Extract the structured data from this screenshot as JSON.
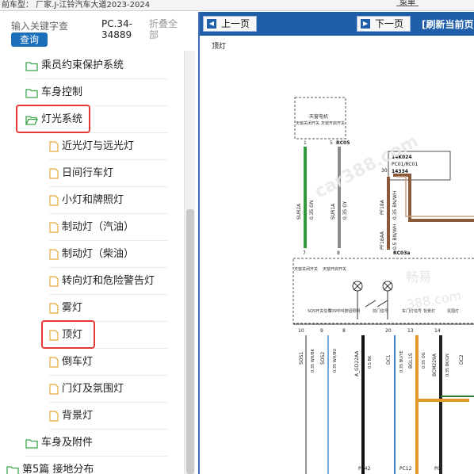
{
  "topbar": {
    "vehicle": "前车型： 厂家.J-江铃汽车大道2023-2024",
    "top_right_button": "菜单"
  },
  "search": {
    "placeholder": "输入关键字查",
    "query_button": "查询",
    "doc_code": "PC.34-34889",
    "fold_all": "折叠全部"
  },
  "tree": {
    "groups": [
      {
        "label": "乘员约束保护系统"
      },
      {
        "label": "车身控制"
      },
      {
        "label": "灯光系统"
      }
    ],
    "light_items": [
      {
        "label": "近光灯与远光灯"
      },
      {
        "label": "日间行车灯"
      },
      {
        "label": "小灯和牌照灯"
      },
      {
        "label": "制动灯（汽油）"
      },
      {
        "label": "制动灯（柴油）"
      },
      {
        "label": "转向灯和危险警告灯"
      },
      {
        "label": "雾灯"
      },
      {
        "label": "顶灯"
      },
      {
        "label": "倒车灯"
      },
      {
        "label": "门灯及氛围灯"
      },
      {
        "label": "背景灯"
      }
    ],
    "after_groups": [
      {
        "label": "车身及附件"
      }
    ],
    "chapter": {
      "label": "第5篇 接地分布"
    }
  },
  "viewer": {
    "prev_label": "上一页",
    "next_label": "下一页",
    "refresh_label": "[刷新当前页",
    "doc_title": "顶灯"
  },
  "diagram": {
    "module_name": "天窗电机",
    "module_pins": [
      "天窗关闭开关",
      "天窗开启开关"
    ],
    "pin_top": [
      "1",
      "5",
      "RC05"
    ],
    "connector": [
      "14K024",
      "PC01/RC01",
      "14334"
    ],
    "pin_30": "30",
    "wire_left": [
      "SUR2A",
      "0.35 GN"
    ],
    "wire_mid": [
      "SUR1A",
      "0.35 GY"
    ],
    "wire_pf18a": [
      "PF18A",
      "0.35 BN/WH"
    ],
    "wire_pf18aa": [
      "PF18AA",
      "0.5 BN/WH"
    ],
    "pin_bottom": [
      "7",
      "8",
      "RC03a"
    ],
    "switch_labels": [
      "天窗关闭开关",
      "天窗开启开关"
    ],
    "signal_labels": [
      "SOS开关信号",
      "SOS呼叫按钮照明",
      "前门信号",
      "车门灯信号",
      "背景灯",
      "氛围灯"
    ],
    "col_pins": [
      "10",
      "9",
      "8",
      "20",
      "13",
      "14"
    ],
    "col_wires": [
      "SOS1",
      "SOS2",
      "A_GD22AA",
      "DC1",
      "BGL1S",
      "BCM229A",
      "DC2"
    ],
    "col_gauges": [
      "0.35 WH/BK",
      "0.35 WH/BU",
      "0.5 BK",
      "0.35 BU/YE",
      "0.35 OG",
      "0.35 BK/GN"
    ],
    "bottom_labels": [
      "PC42",
      "PC12",
      "PC"
    ],
    "watermarks": [
      "car388.com",
      "畅易",
      "388.com"
    ]
  }
}
